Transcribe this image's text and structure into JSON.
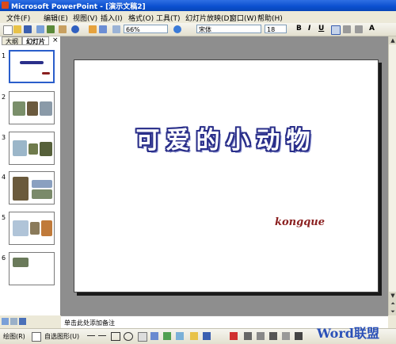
{
  "window": {
    "title": "Microsoft PowerPoint - [演示文稿2]"
  },
  "menu": [
    "文件(F)",
    "编辑(E)",
    "视图(V)",
    "插入(I)",
    "格式(O)",
    "工具(T)",
    "幻灯片放映(D)",
    "窗口(W)",
    "帮助(H)"
  ],
  "toolbar": {
    "zoom": "66%",
    "font": "宋体",
    "size": "18",
    "bold": "B",
    "italic": "I",
    "underline": "U",
    "grow_font": "A"
  },
  "left_pane": {
    "tabs": [
      "大纲",
      "幻灯片"
    ],
    "close": "×",
    "slides": [
      "1",
      "2",
      "3",
      "4",
      "5",
      "6"
    ]
  },
  "slide": {
    "title": "可爱的小动物",
    "subtitle": "kongque"
  },
  "notes": {
    "placeholder": "单击此处添加备注"
  },
  "drawing": {
    "draw_label": "绘图(R)",
    "autoshape_label": "自选图形(U)"
  },
  "watermark": {
    "text": "Word联盟"
  },
  "colors": {
    "title_bar": "#0a4fcf",
    "selection": "#2a5ecb",
    "slide_title_outline": "#2a2f8a",
    "subtitle": "#8a1f1f"
  }
}
